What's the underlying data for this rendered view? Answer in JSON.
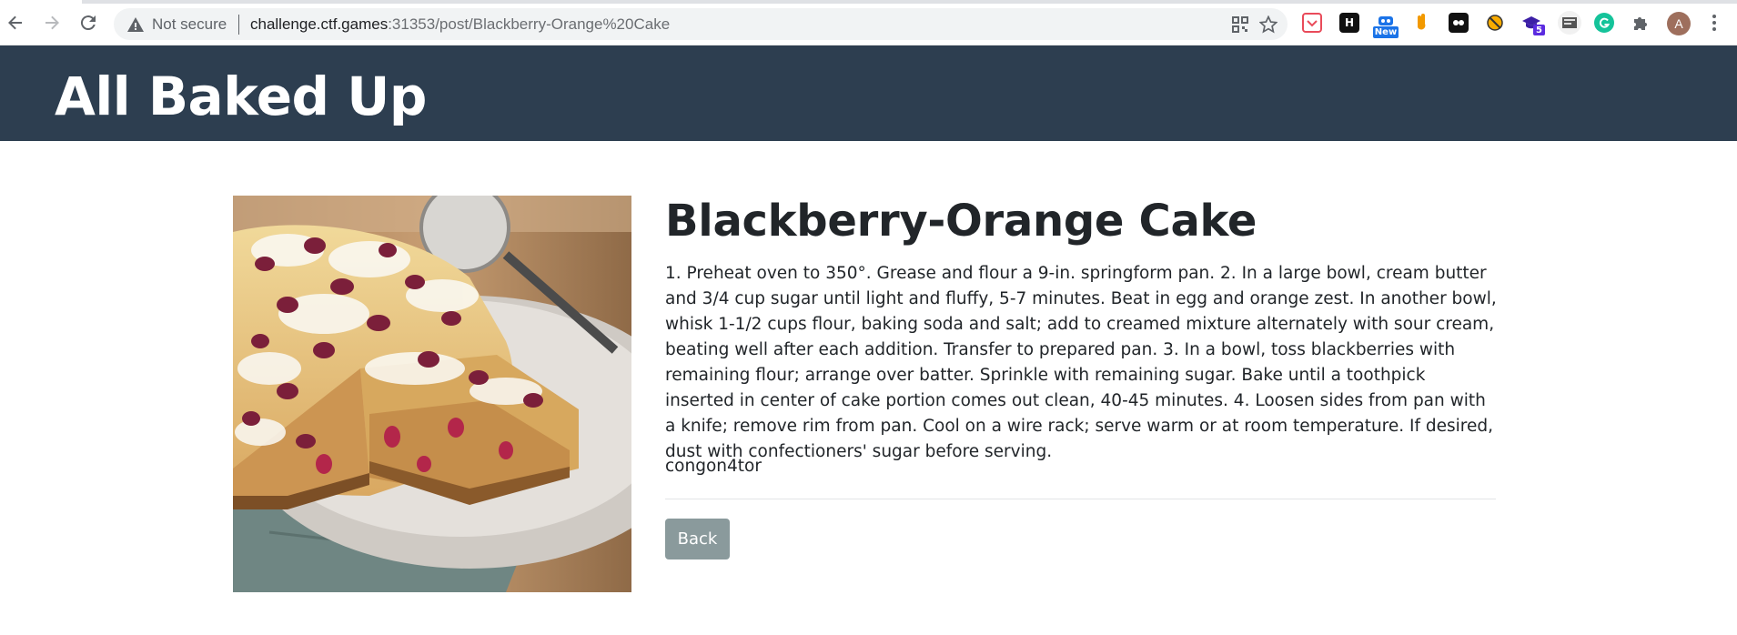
{
  "browser": {
    "security_label": "Not secure",
    "url_host": "challenge.ctf.games",
    "url_path": ":31353/post/Blackberry-Orange%20Cake",
    "profile_initial": "A",
    "extensions": [
      {
        "icon": "pocket-icon",
        "color": "#e94b5a"
      },
      {
        "icon": "h-icon",
        "color": "#111111",
        "text": "H"
      },
      {
        "icon": "new-extension-icon",
        "color": "#1a73e8",
        "badge": "New"
      },
      {
        "icon": "hand-icon",
        "color": "#f29900"
      },
      {
        "icon": "bitwarden-like-icon",
        "color": "#111111"
      },
      {
        "icon": "block-icon",
        "color": "#f9ab00"
      },
      {
        "icon": "grad-cap-icon",
        "color": "#3c1fa6",
        "badge": "5"
      },
      {
        "icon": "screen-icon",
        "color": "#444444"
      },
      {
        "icon": "grammarly-icon",
        "color": "#15c39a"
      },
      {
        "icon": "puzzle-icon",
        "color": "#5f6368"
      }
    ]
  },
  "site": {
    "title": "All Baked Up"
  },
  "post": {
    "title": "Blackberry-Orange Cake",
    "body": "1. Preheat oven to 350°. Grease and flour a 9-in. springform pan. 2. In a large bowl, cream butter and 3/4 cup sugar until light and fluffy, 5-7 minutes. Beat in egg and orange zest. In another bowl, whisk 1-1/2 cups flour, baking soda and salt; add to creamed mixture alternately with sour cream, beating well after each addition. Transfer to prepared pan. 3. In a bowl, toss blackberries with remaining flour; arrange over batter. Sprinkle with remaining sugar. Bake until a toothpick inserted in center of cake portion comes out clean, 40-45 minutes. 4. Loosen sides from pan with a knife; remove rim from pan. Cool on a wire rack; serve warm or at room temperature. If desired, dust with confectioners' sugar before serving.",
    "author": "congon4tor",
    "back_label": "Back"
  },
  "colors": {
    "header_bg": "#2d3e50",
    "back_button_bg": "#8a9a9c"
  }
}
